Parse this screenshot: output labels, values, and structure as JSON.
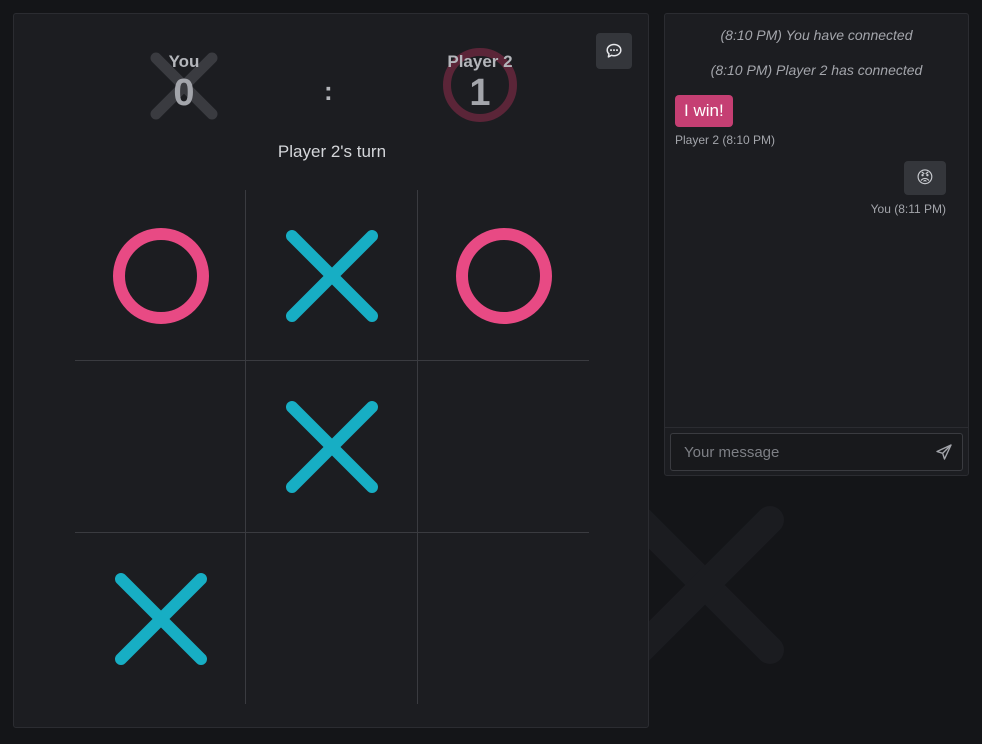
{
  "app": {
    "bg_color": "#141518",
    "x_color": "#17aec4",
    "o_color": "#e84a84"
  },
  "scoreboard": {
    "players": [
      {
        "name": "You",
        "score": "0",
        "mark": "X"
      },
      {
        "name": "Player 2",
        "score": "1",
        "mark": "O"
      }
    ],
    "separator": ":",
    "chat_toggle_icon": "chat-bubble-icon"
  },
  "turn": {
    "label": "Player 2's turn"
  },
  "board": {
    "cells": [
      "O",
      "X",
      "O",
      "",
      "X",
      "",
      "X",
      "",
      ""
    ]
  },
  "chat": {
    "system_messages": [
      "(8:10 PM) You have connected",
      "(8:10 PM) Player 2 has connected"
    ],
    "messages": [
      {
        "text": "I win!",
        "meta": "Player 2 (8:10 PM)",
        "side": "incoming"
      },
      {
        "text": "😡",
        "meta": "You (8:11 PM)",
        "side": "outgoing"
      }
    ],
    "input": {
      "value": "",
      "placeholder": "Your message"
    },
    "send_icon": "send-icon"
  }
}
